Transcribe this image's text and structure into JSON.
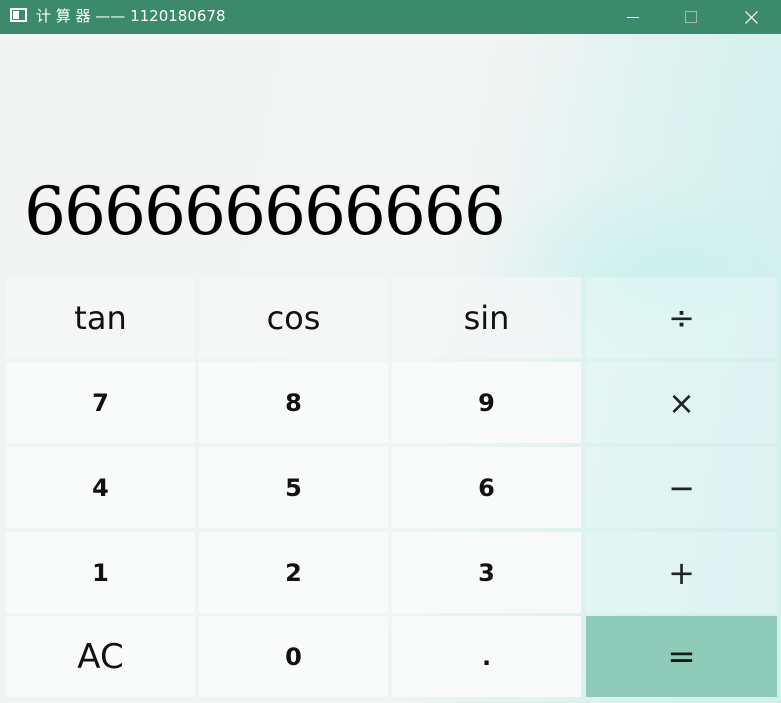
{
  "window": {
    "title": "计 算 器 —— 1120180678",
    "title_bar_color": "#3c8a6c"
  },
  "icons": {
    "app": "calculator-app-icon",
    "minimize": "minimize-icon",
    "maximize": "maximize-icon",
    "close": "close-icon"
  },
  "display": {
    "value": "666666666666"
  },
  "keys": {
    "tan": "tan",
    "cos": "cos",
    "sin": "sin",
    "divide": "÷",
    "seven": "7",
    "eight": "8",
    "nine": "9",
    "multiply": "×",
    "four": "4",
    "five": "5",
    "six": "6",
    "minus": "−",
    "one": "1",
    "two": "2",
    "three": "3",
    "plus": "+",
    "clear": "AC",
    "zero": "0",
    "decimal": ".",
    "equals": "="
  },
  "colors": {
    "equals_button": "#8ecbb8"
  }
}
